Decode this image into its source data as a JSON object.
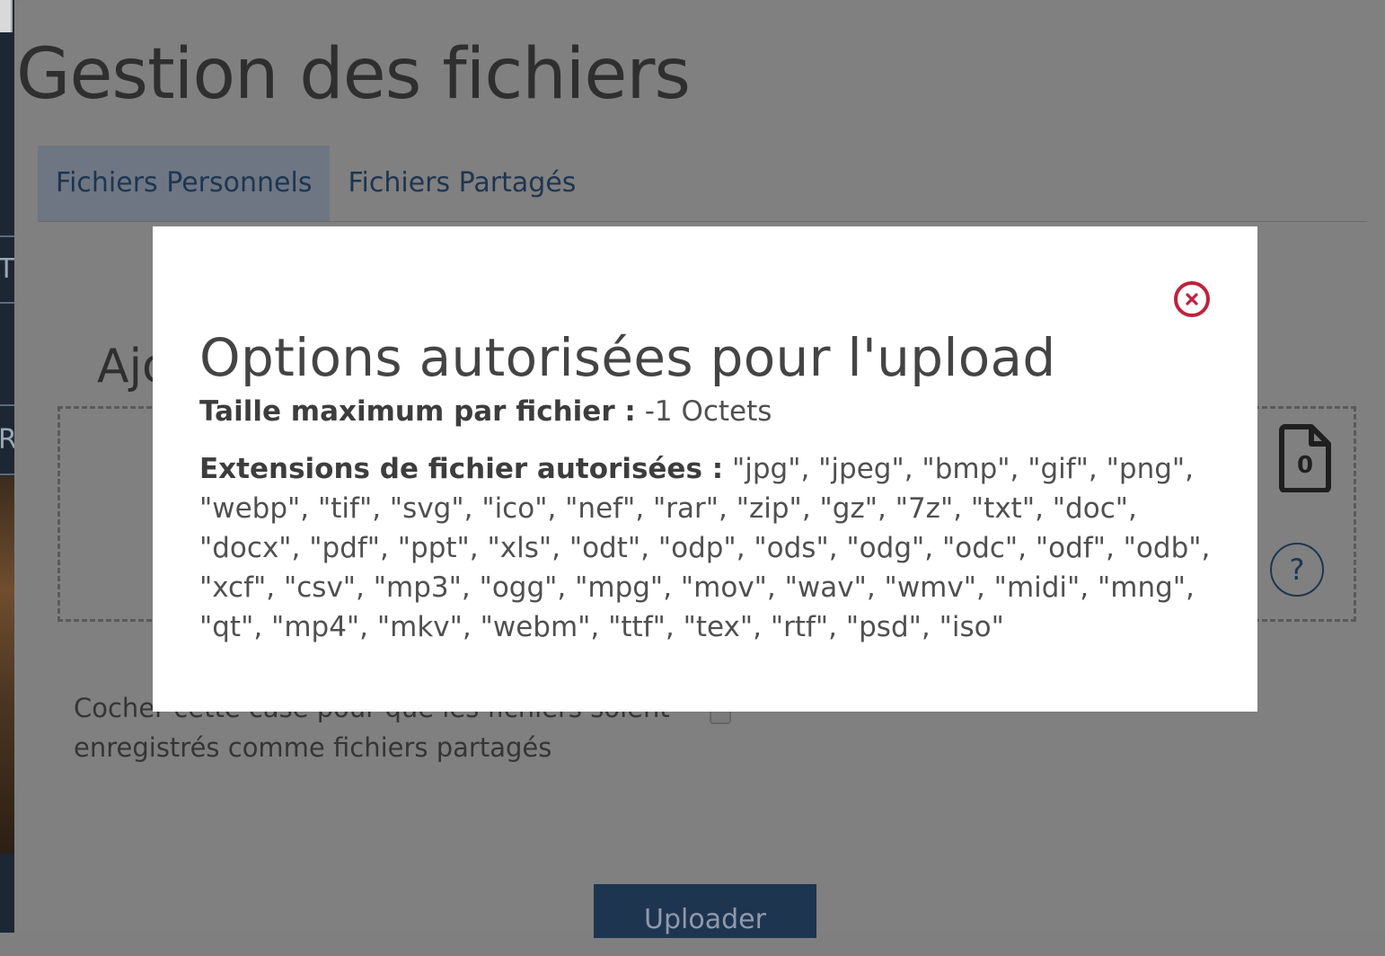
{
  "page": {
    "title": "Gestion des fichiers",
    "tabs": [
      {
        "label": "Fichiers Personnels",
        "active": true
      },
      {
        "label": "Fichiers Partagés",
        "active": false
      }
    ],
    "section_heading_partial": "Ajo",
    "file_count": "0",
    "help_label": "?",
    "share_checkbox_label": "Cocher cette case pour que les fichiers soient enregistrés comme fichiers partagés",
    "upload_button": "Uploader",
    "sidebar_letters": [
      "T",
      "R"
    ]
  },
  "modal": {
    "title": "Options autorisées pour l'upload",
    "max_size_label": "Taille maximum par fichier :",
    "max_size_value": "-1 Octets",
    "extensions_label": "Extensions de fichier autorisées :",
    "extensions_value": "\"jpg\", \"jpeg\", \"bmp\", \"gif\", \"png\", \"webp\", \"tif\", \"svg\", \"ico\", \"nef\", \"rar\", \"zip\", \"gz\", \"7z\", \"txt\", \"doc\", \"docx\", \"pdf\", \"ppt\", \"xls\", \"odt\", \"odp\", \"ods\", \"odg\", \"odc\", \"odf\", \"odb\", \"xcf\", \"csv\", \"mp3\", \"ogg\", \"mpg\", \"mov\", \"wav\", \"wmv\", \"midi\", \"mng\", \"qt\", \"mp4\", \"mkv\", \"webm\", \"ttf\", \"tex\", \"rtf\", \"psd\", \"iso\"",
    "close_icon": "close-circle-icon"
  },
  "colors": {
    "overlay": "#7f7f7f",
    "accent_dark_blue": "#1e3550",
    "close_red": "#c0223b"
  }
}
